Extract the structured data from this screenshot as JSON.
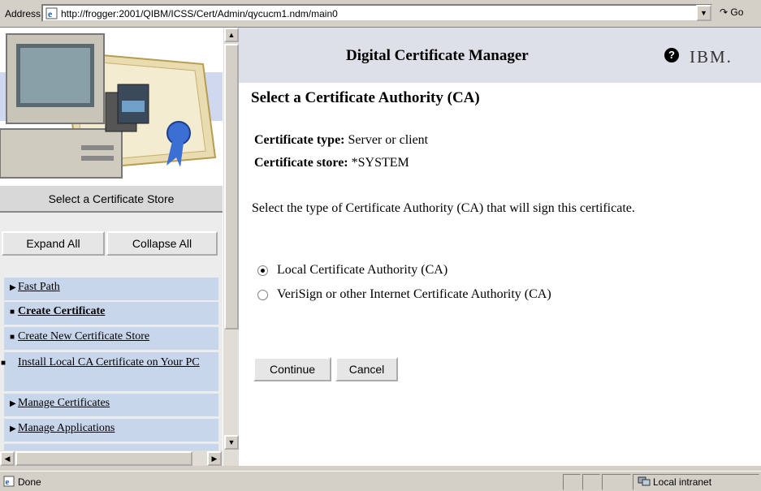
{
  "address_bar": {
    "label": "Address",
    "url": "http://frogger:2001/QIBM/ICSS/Cert/Admin/qycucm1.ndm/main0",
    "go_label": "Go"
  },
  "sidebar": {
    "store_title": "Select a Certificate Store",
    "expand_label": "Expand All",
    "collapse_label": "Collapse All",
    "items": [
      {
        "label": "Fast Path",
        "bullet": "▶"
      },
      {
        "label": "Create Certificate",
        "bullet": "■"
      },
      {
        "label": "Create New Certificate Store",
        "bullet": "■"
      },
      {
        "label": "Install Local CA Certificate on Your PC",
        "bullet": "■"
      },
      {
        "label": "Manage Certificates",
        "bullet": "▶"
      },
      {
        "label": "Manage Applications",
        "bullet": "▶"
      }
    ]
  },
  "header": {
    "title": "Digital Certificate Manager",
    "help_symbol": "?",
    "brand": "IBM."
  },
  "main": {
    "title": "Select a Certificate Authority (CA)",
    "cert_type_label": "Certificate type:",
    "cert_type_value": "Server or client",
    "cert_store_label": "Certificate store:",
    "cert_store_value": "*SYSTEM",
    "description": "Select the type of Certificate Authority (CA) that will sign this certificate.",
    "options": [
      {
        "label": "Local Certificate Authority (CA)",
        "checked": true
      },
      {
        "label": "VeriSign or other Internet Certificate Authority (CA)",
        "checked": false
      }
    ],
    "continue_label": "Continue",
    "cancel_label": "Cancel"
  },
  "status_bar": {
    "text": "Done",
    "zone": "Local intranet"
  },
  "colors": {
    "nav_item_bg": "#c8d6ec",
    "header_bg": "#dde0e8"
  }
}
